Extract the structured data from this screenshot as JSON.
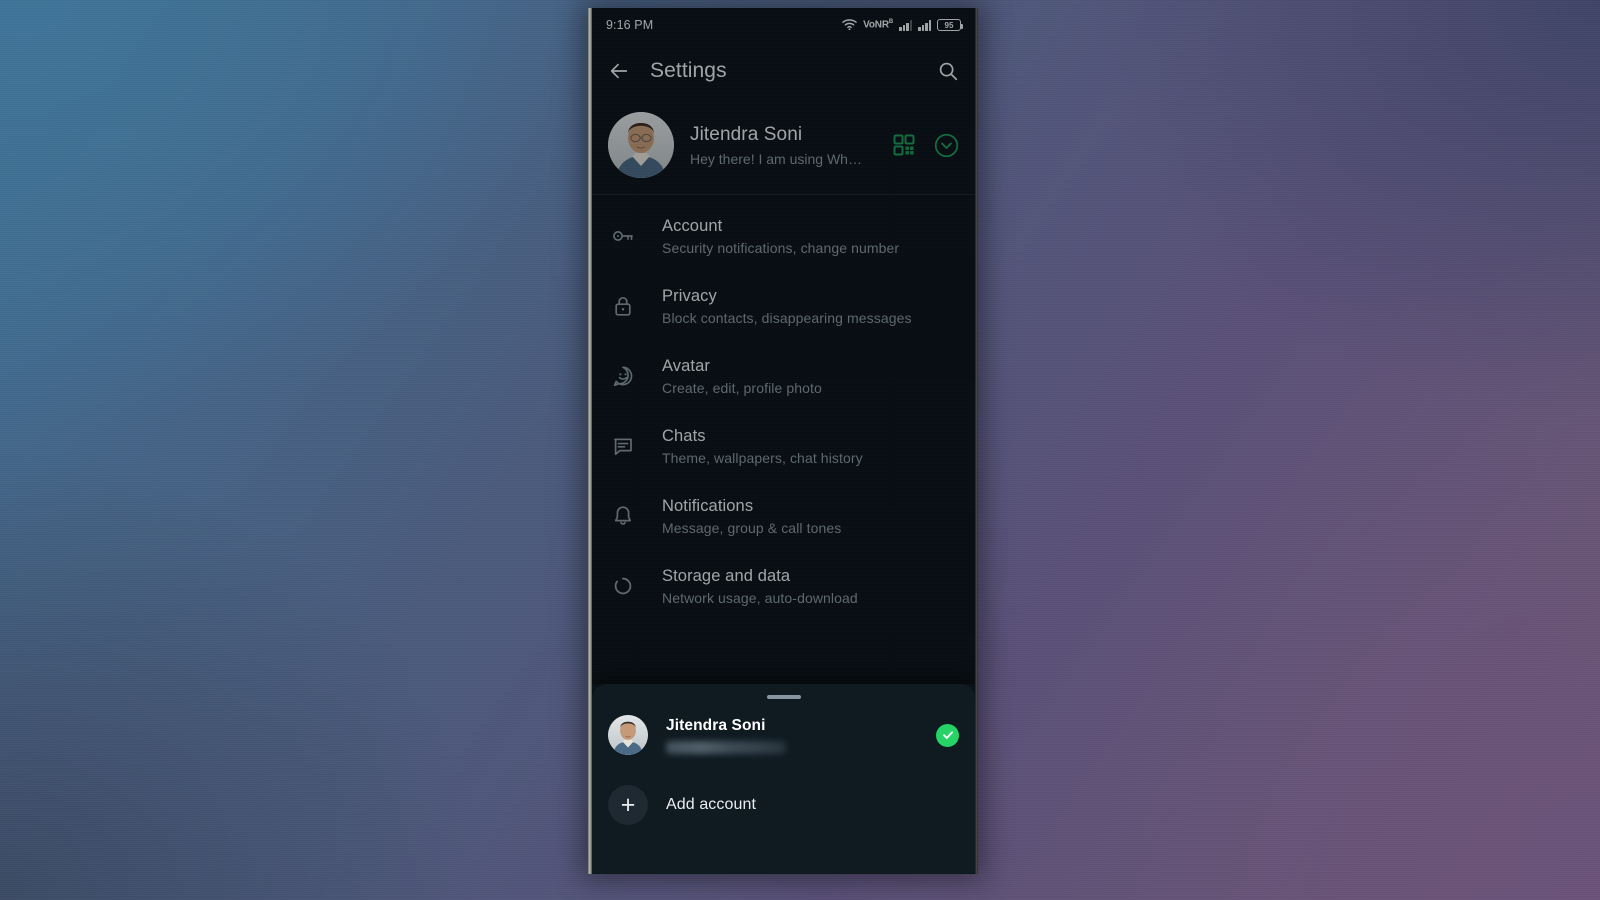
{
  "statusbar": {
    "clock": "9:16 PM",
    "network_label": "VoNR",
    "network_sup": "B",
    "battery": "95",
    "icons": [
      "wifi-icon",
      "vonr-label",
      "signal-bars-sim1",
      "signal-bars-sim2",
      "battery-icon"
    ]
  },
  "appbar": {
    "back_icon": "back-arrow-icon",
    "title": "Settings",
    "search_icon": "search-icon"
  },
  "profile": {
    "name": "Jitendra Soni",
    "status": "Hey there! I am using Wh…",
    "avatar": "profile-avatar",
    "qr_icon": "qr-code-icon",
    "expand_icon": "chevron-down-circle-icon",
    "accent": "#00a884"
  },
  "settings": {
    "items": [
      {
        "icon": "key-icon",
        "title": "Account",
        "subtitle": "Security notifications, change number"
      },
      {
        "icon": "lock-icon",
        "title": "Privacy",
        "subtitle": "Block contacts, disappearing messages"
      },
      {
        "icon": "avatar-icon",
        "title": "Avatar",
        "subtitle": "Create, edit, profile photo"
      },
      {
        "icon": "chat-icon",
        "title": "Chats",
        "subtitle": "Theme, wallpapers, chat history"
      },
      {
        "icon": "bell-icon",
        "title": "Notifications",
        "subtitle": "Message, group & call tones"
      },
      {
        "icon": "refresh-icon",
        "title": "Storage and data",
        "subtitle": "Network usage, auto-download"
      }
    ]
  },
  "bottom_sheet": {
    "handle": "drag-handle",
    "account": {
      "name": "Jitendra Soni",
      "phone": "",
      "avatar": "account-avatar",
      "selected_icon": "check-circle-icon",
      "selected_color": "#25d366"
    },
    "add_account": {
      "icon": "plus-icon",
      "label": "Add account"
    }
  },
  "theme": {
    "background": "#0b141b",
    "sheet_background": "#0f1a21",
    "primary_text": "#e9edef",
    "secondary_text": "#8696a0",
    "accent_green": "#00a884"
  }
}
